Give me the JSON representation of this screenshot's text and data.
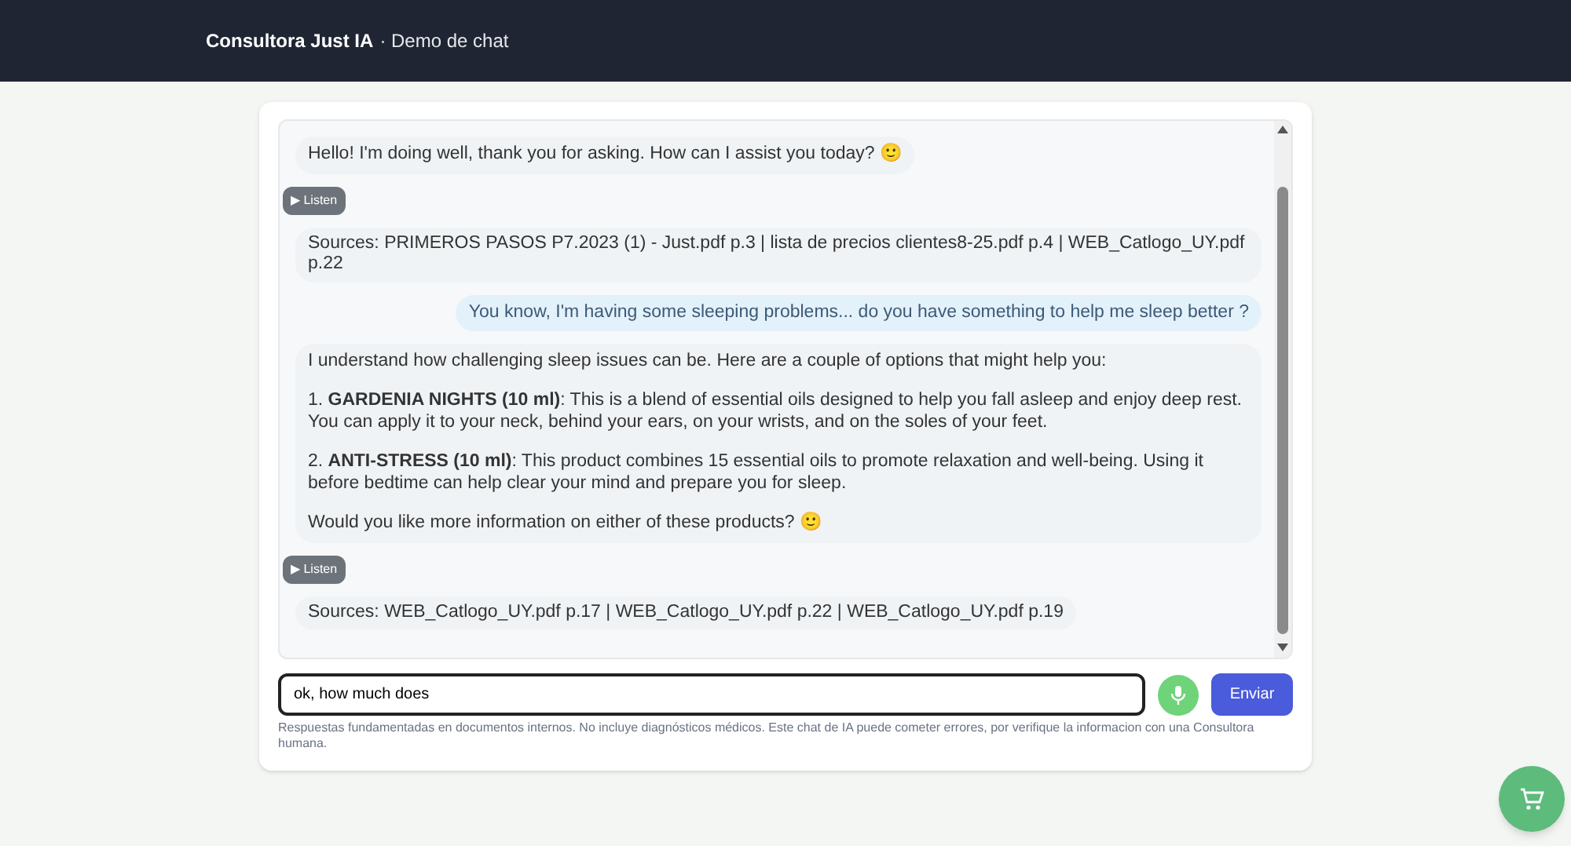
{
  "header": {
    "brand": "Consultora Just IA",
    "subtitle": "· Demo de chat"
  },
  "messages": [
    {
      "kind": "bot",
      "paragraphs": [
        "Hello! I'm doing well, thank you for asking. How can I assist you today? 🙂"
      ],
      "listen": "▶ Listen",
      "sources": "Sources: PRIMEROS PASOS P7.2023 (1) - Just.pdf p.3 | lista de precios clientes8-25.pdf p.4 | WEB_Catlogo_UY.pdf p.22"
    },
    {
      "kind": "user",
      "text": "You know, I'm having some sleeping problems... do you have something to help me sleep better ?"
    },
    {
      "kind": "bot",
      "paragraphs": [
        "I understand how challenging sleep issues can be. Here are a couple of options that might help you:",
        "1. **GARDENIA NIGHTS (10 ml)**: This is a blend of essential oils designed to help you fall asleep and enjoy deep rest. You can apply it to your neck, behind your ears, on your wrists, and on the soles of your feet.",
        "2. **ANTI-STRESS (10 ml)**: This product combines 15 essential oils to promote relaxation and well-being. Using it before bedtime can help clear your mind and prepare you for sleep.",
        "Would you like more information on either of these products? 🙂"
      ],
      "listen": "▶ Listen",
      "sources": "Sources: WEB_Catlogo_UY.pdf p.17 | WEB_Catlogo_UY.pdf p.22 | WEB_Catlogo_UY.pdf p.19"
    }
  ],
  "composer": {
    "value": "ok, how much does ",
    "send": "Enviar"
  },
  "disclaimer": "Respuestas fundamentadas en documentos internos. No incluye diagnósticos médicos. Este chat de IA puede cometer errores, por verifique la informacion con una Consultora humana."
}
